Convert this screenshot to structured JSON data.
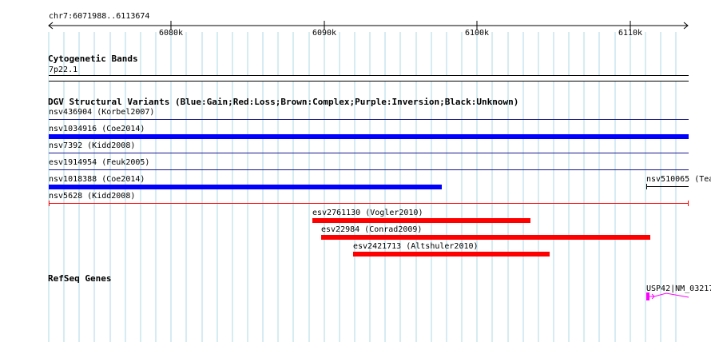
{
  "ruler": {
    "label": "chr7:6071988..6113674",
    "ticks": [
      {
        "label": "6080k",
        "major": true
      },
      {
        "label": "6090k",
        "major": true
      },
      {
        "label": "6100k",
        "major": true
      },
      {
        "label": "6110k",
        "major": true
      }
    ]
  },
  "cytoband": {
    "title": "Cytogenetic Bands",
    "band": "7p22.1"
  },
  "dgv": {
    "title": "DGV Structural Variants (Blue:Gain;Red:Loss;Brown:Complex;Purple:Inversion;Black:Unknown)",
    "features": [
      {
        "label": "nsv436904 (Korbel2007)",
        "type": "inversion"
      },
      {
        "label": "nsv1034916 (Coe2014)",
        "type": "gain"
      },
      {
        "label": "nsv7392 (Kidd2008)",
        "type": "inversion"
      },
      {
        "label": "esv1914954 (Feuk2005)",
        "type": "inversion"
      },
      {
        "label": "nsv1018388 (Coe2014)",
        "type": "gain"
      },
      {
        "label": "nsv510065 (Tea",
        "type": "unknown"
      },
      {
        "label": "nsv5628 (Kidd2008)",
        "type": "loss"
      },
      {
        "label": "esv2761130 (Vogler2010)",
        "type": "loss"
      },
      {
        "label": "esv22984 (Conrad2009)",
        "type": "loss"
      },
      {
        "label": "esv2421713 (Altshuler2010)",
        "type": "loss"
      }
    ]
  },
  "refseq": {
    "title": "RefSeq Genes",
    "gene_label": "USP42|NM_03217"
  },
  "colors": {
    "grid": "#add8e6",
    "gain": "#0000ff",
    "loss": "#ff0000",
    "inversion": "#800080",
    "unknown": "#000000",
    "gene": "#ff00ff"
  }
}
